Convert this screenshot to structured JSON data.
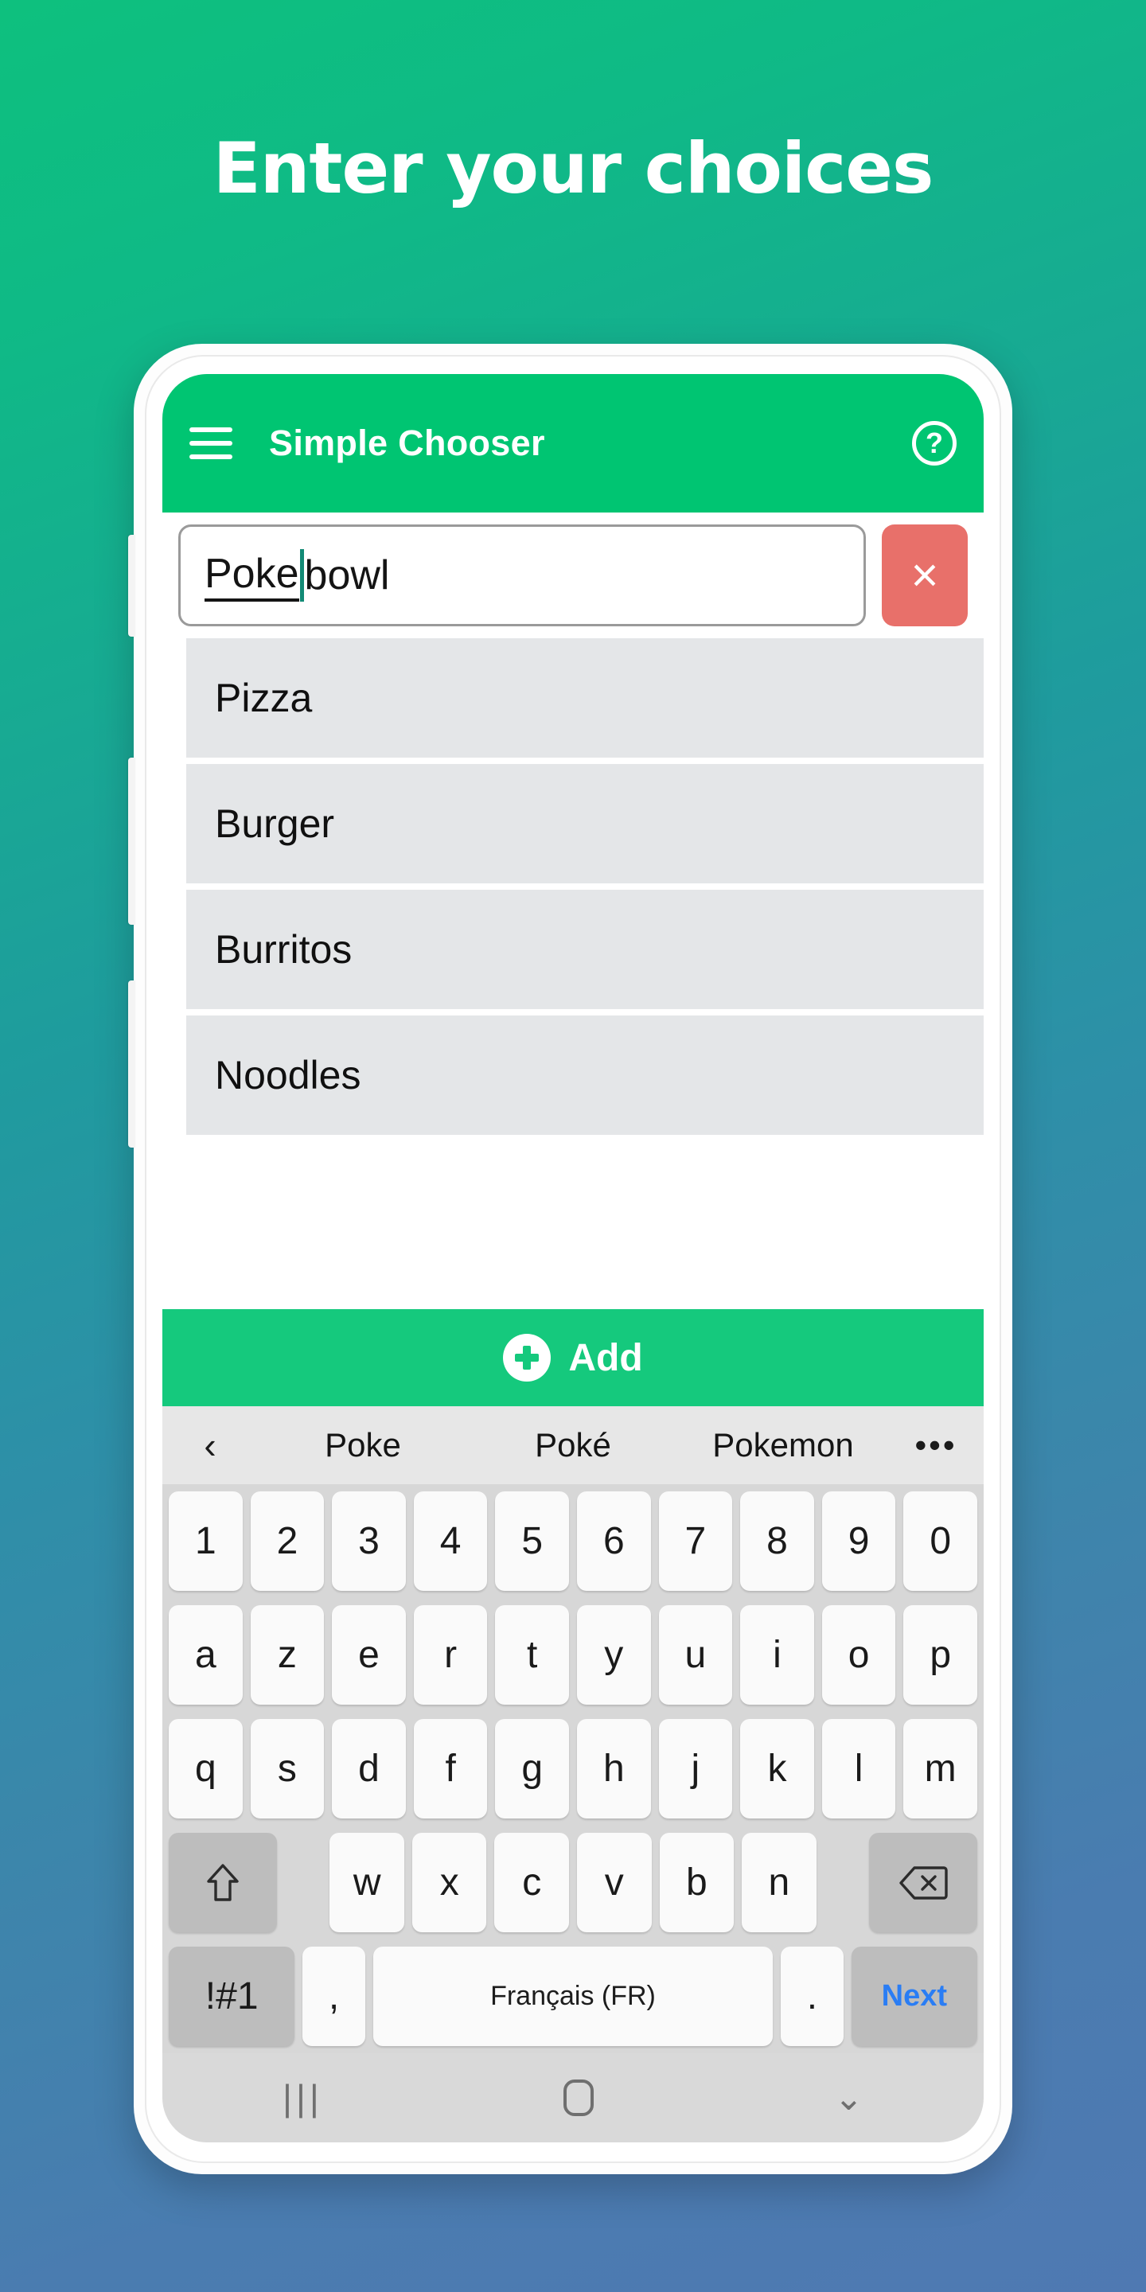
{
  "headline": "Enter your choices",
  "colors": {
    "bg_top": "#0ec07e",
    "bg_bottom": "#4f79b2",
    "appbar_green": "#00C572",
    "add_green": "#15C97D",
    "clear_red": "#E8706A",
    "list_gray": "#E4E6E8",
    "next_blue": "#2a7DF4"
  },
  "appbar": {
    "menu_icon": "hamburger-menu-icon",
    "title": "Simple Chooser",
    "help_icon": "?"
  },
  "input": {
    "composing_text": "Poke",
    "rest_text": " bowl",
    "full_value": "Poke bowl",
    "placeholder": "",
    "clear_label": "×"
  },
  "list": {
    "items": [
      {
        "label": "Pizza"
      },
      {
        "label": "Burger"
      },
      {
        "label": "Burritos"
      },
      {
        "label": "Noodles"
      }
    ]
  },
  "add_button": {
    "label": "Add",
    "icon": "plus-circle-icon"
  },
  "keyboard": {
    "suggestions": {
      "back_icon": "‹",
      "items": [
        "Poke",
        "Poké",
        "Pokemon"
      ],
      "more_icon": "•••"
    },
    "rows": {
      "digits": [
        "1",
        "2",
        "3",
        "4",
        "5",
        "6",
        "7",
        "8",
        "9",
        "0"
      ],
      "row1": [
        "a",
        "z",
        "e",
        "r",
        "t",
        "y",
        "u",
        "i",
        "o",
        "p"
      ],
      "row2": [
        "q",
        "s",
        "d",
        "f",
        "g",
        "h",
        "j",
        "k",
        "l",
        "m"
      ],
      "row3": [
        "w",
        "x",
        "c",
        "v",
        "b",
        "n"
      ],
      "shift_icon": "shift-arrow-icon",
      "backspace_icon": "backspace-icon"
    },
    "bottom": {
      "symbols": "!#1",
      "comma": ",",
      "space_label": "Français (FR)",
      "period": ".",
      "action": "Next"
    }
  },
  "navbar": {
    "recents": "|||",
    "home_icon": "home-icon",
    "down_icon": "⌄"
  }
}
